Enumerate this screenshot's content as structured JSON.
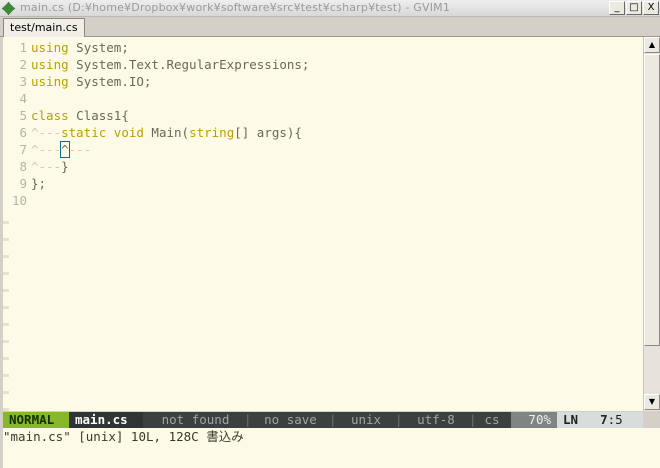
{
  "window": {
    "title": "main.cs (D:¥home¥Dropbox¥work¥software¥src¥test¥csharp¥test) - GVIM1",
    "buttons": {
      "minimize": "_",
      "maximize": "□",
      "close": "X"
    }
  },
  "tab": {
    "label": "test/main.cs"
  },
  "editor": {
    "lines": [
      {
        "num": "1",
        "parts": [
          {
            "t": "using",
            "c": "kw"
          },
          {
            "t": " System;",
            "c": "code"
          }
        ]
      },
      {
        "num": "2",
        "parts": [
          {
            "t": "using",
            "c": "kw"
          },
          {
            "t": " System.Text.RegularExpressions;",
            "c": "code"
          }
        ]
      },
      {
        "num": "3",
        "parts": [
          {
            "t": "using",
            "c": "kw"
          },
          {
            "t": " System.IO;",
            "c": "code"
          }
        ]
      },
      {
        "num": "4",
        "parts": []
      },
      {
        "num": "5",
        "parts": [
          {
            "t": "class",
            "c": "kw"
          },
          {
            "t": " Class1{",
            "c": "code"
          }
        ]
      },
      {
        "num": "6",
        "parts": [
          {
            "t": "^---",
            "c": "tabmark"
          },
          {
            "t": "static",
            "c": "kw"
          },
          {
            "t": " ",
            "c": "code"
          },
          {
            "t": "void",
            "c": "kw"
          },
          {
            "t": " Main(",
            "c": "code"
          },
          {
            "t": "string",
            "c": "ty"
          },
          {
            "t": "[] args){",
            "c": "code"
          }
        ]
      },
      {
        "num": "7",
        "parts": [
          {
            "t": "^---",
            "c": "tabmark"
          },
          {
            "t": "^",
            "c": "cursor"
          },
          {
            "t": "---",
            "c": "tabmark"
          }
        ]
      },
      {
        "num": "8",
        "parts": [
          {
            "t": "^---",
            "c": "tabmark"
          },
          {
            "t": "}",
            "c": "code"
          }
        ]
      },
      {
        "num": "9",
        "parts": [
          {
            "t": "};",
            "c": "code"
          }
        ]
      },
      {
        "num": "10",
        "parts": []
      }
    ]
  },
  "statusline": {
    "mode": "NORMAL",
    "filename": "main.cs",
    "segments": [
      "not found",
      "no save",
      "unix",
      "utf-8",
      "cs"
    ],
    "percent": "70%",
    "ln_label": "LN",
    "line": "7",
    "col": "5"
  },
  "message": "\"main.cs\" [unix] 10L, 128C 書込み"
}
